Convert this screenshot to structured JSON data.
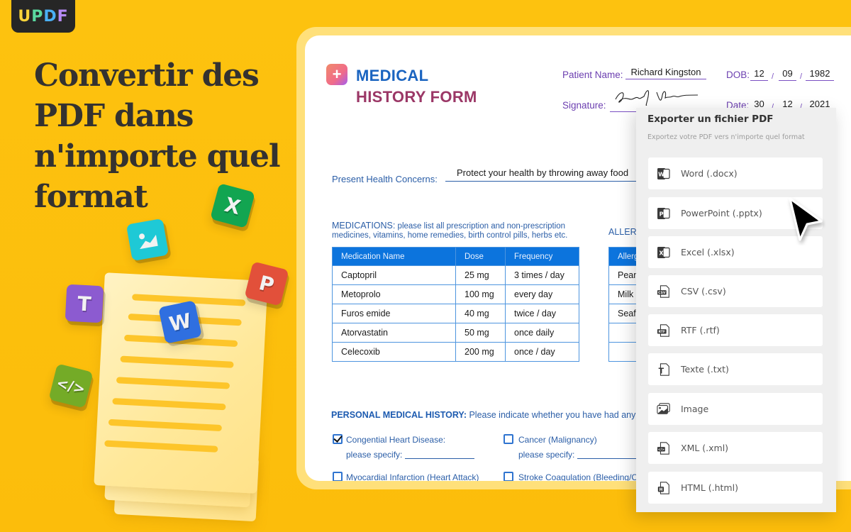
{
  "brand": {
    "logo_letters": [
      "U",
      "P",
      "D",
      "F"
    ]
  },
  "headline": {
    "lines": [
      "Convertir des",
      "PDF dans",
      "n'importe quel",
      "format"
    ]
  },
  "illustration": {
    "tiles": [
      {
        "name": "excel-tile",
        "glyph": "X",
        "color": "#12a551"
      },
      {
        "name": "image-tile",
        "glyph": "",
        "color": "#1ec9d6"
      },
      {
        "name": "text-tile",
        "glyph": "T",
        "color": "#8c5bd0"
      },
      {
        "name": "word-tile",
        "glyph": "W",
        "color": "#2f6fe0"
      },
      {
        "name": "powerpoint-tile",
        "glyph": "P",
        "color": "#e2503a"
      },
      {
        "name": "code-tile",
        "glyph": "</>",
        "color": "#74ab27"
      }
    ]
  },
  "form": {
    "title_line1": "MEDICAL",
    "title_line2": "HISTORY FORM",
    "patient_name_label": "Patient Name:",
    "patient_name": "Richard Kingston",
    "dob_label": "DOB:",
    "dob": {
      "day": "12",
      "month": "09",
      "year": "1982"
    },
    "signature_label": "Signature:",
    "signature": "Richard Nixon",
    "date_label": "Date:",
    "date": {
      "day": "30",
      "month": "12",
      "year": "2021"
    },
    "date_separator": "/",
    "concerns_label": "Present Health Concerns:",
    "concerns_value": "Protect your health by throwing away food",
    "medications_caption_head": "MEDICATIONS:",
    "medications_caption_body": " please list all prescription and non-prescription medicines, vitamins, home remedies, birth control pills, herbs etc.",
    "medications_headers": [
      "Medication Name",
      "Dose",
      "Frequency"
    ],
    "medications": [
      {
        "name": "Captopril",
        "dose": "25 mg",
        "frequency": "3 times / day"
      },
      {
        "name": "Metoprolo",
        "dose": "100 mg",
        "frequency": "every day"
      },
      {
        "name": "Furos emide",
        "dose": "40 mg",
        "frequency": "twice / day"
      },
      {
        "name": "Atorvastatin",
        "dose": "50 mg",
        "frequency": "once daily"
      },
      {
        "name": "Celecoxib",
        "dose": "200 mg",
        "frequency": "once / day"
      }
    ],
    "allergies_caption": "ALLERGIES",
    "allergies_header": "Allergies",
    "allergies": [
      "Peanuts",
      "Milk",
      "Seafood",
      "",
      ""
    ],
    "pmh_title": "PERSONAL MEDICAL HISTORY:",
    "pmh_subtitle": " Please indicate whether you have had any of the following",
    "conditions": [
      {
        "label": "Congential Heart Disease:",
        "checked": true,
        "specify": "please specify:"
      },
      {
        "label": "Cancer (Malignancy)",
        "checked": false,
        "specify": "please specify:"
      },
      {
        "label": "Myocardial Infarction (Heart Attack)",
        "checked": false
      },
      {
        "label": "Stroke Coagulation (Bleeding/Clotting)",
        "checked": false
      }
    ]
  },
  "export_panel": {
    "title": "Exporter un fichier PDF",
    "subtitle": "Exportez votre PDF vers n'importe quel format",
    "options": [
      {
        "label": "Word (.docx)",
        "icon": "word-icon",
        "badge": "W"
      },
      {
        "label": "PowerPoint (.pptx)",
        "icon": "powerpoint-icon",
        "badge": "P"
      },
      {
        "label": "Excel (.xlsx)",
        "icon": "excel-icon",
        "badge": "X"
      },
      {
        "label": "CSV (.csv)",
        "icon": "csv-icon",
        "badge": "CSV"
      },
      {
        "label": "RTF (.rtf)",
        "icon": "rtf-icon",
        "badge": "RTF"
      },
      {
        "label": "Texte (.txt)",
        "icon": "text-file-icon",
        "badge": "T"
      },
      {
        "label": "Image",
        "icon": "image-icon",
        "badge": ""
      },
      {
        "label": "XML (.xml)",
        "icon": "xml-icon",
        "badge": "</>"
      },
      {
        "label": "HTML (.html)",
        "icon": "html-icon",
        "badge": "H"
      }
    ]
  }
}
